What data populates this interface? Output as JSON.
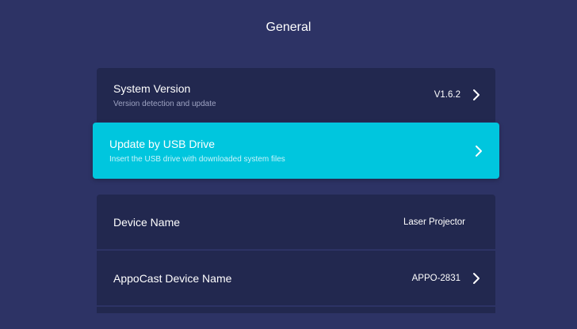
{
  "header": {
    "title": "General"
  },
  "settings": {
    "system_version": {
      "title": "System Version",
      "subtitle": "Version detection and update",
      "value": "V1.6.2",
      "icon": "chevron-right-icon"
    },
    "usb_update": {
      "title": "Update by USB Drive",
      "subtitle": "Insert the USB drive with downloaded system files",
      "icon": "chevron-right-icon"
    },
    "device_name": {
      "title": "Device Name",
      "value": "Laser Projector"
    },
    "appocast_device_name": {
      "title": "AppoCast Device Name",
      "value": "APPO-2831",
      "icon": "chevron-right-icon"
    }
  },
  "colors": {
    "background": "#2d3365",
    "card": "#22284f",
    "focus": "#00c6de"
  }
}
